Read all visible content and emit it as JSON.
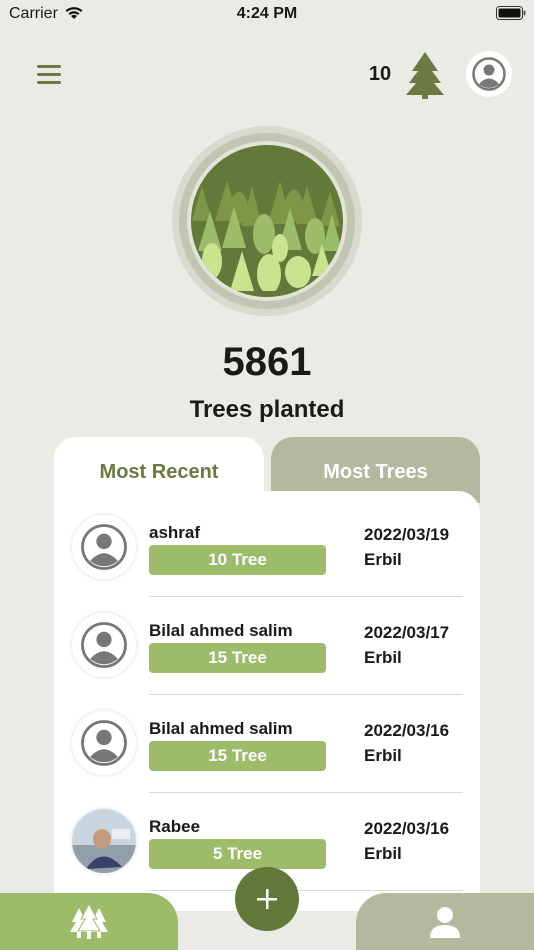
{
  "status_bar": {
    "carrier": "Carrier",
    "time": "4:24 PM"
  },
  "header": {
    "user_tree_count": "10",
    "menu_icon": "hamburger-menu-icon",
    "tree_icon": "pine-tree-icon",
    "profile_icon": "user-avatar-icon"
  },
  "summary": {
    "total_trees": "5861",
    "label": "Trees planted"
  },
  "tabs": [
    {
      "label": "Most Recent",
      "active": true
    },
    {
      "label": "Most Trees",
      "active": false
    }
  ],
  "entries": [
    {
      "name": "ashraf",
      "trees": "10 Tree",
      "date": "2022/03/19",
      "city": "Erbil",
      "avatar": "default-avatar-icon"
    },
    {
      "name": "Bilal ahmed salim",
      "trees": "15 Tree",
      "date": "2022/03/17",
      "city": "Erbil",
      "avatar": "default-avatar-icon"
    },
    {
      "name": "Bilal ahmed salim",
      "trees": "15 Tree",
      "date": "2022/03/16",
      "city": "Erbil",
      "avatar": "default-avatar-icon"
    },
    {
      "name": "Rabee",
      "trees": "5 Tree",
      "date": "2022/03/16",
      "city": "Erbil",
      "avatar": "photo-avatar"
    }
  ],
  "bottom_nav": {
    "left_icon": "forest-icon",
    "center_icon": "plus-icon",
    "right_icon": "profile-icon"
  },
  "colors": {
    "background": "#ebebe5",
    "accent_green": "#9cbc6a",
    "dark_green": "#62793a",
    "muted_olive": "#b4b89c",
    "menu_green": "#6a7a40"
  }
}
